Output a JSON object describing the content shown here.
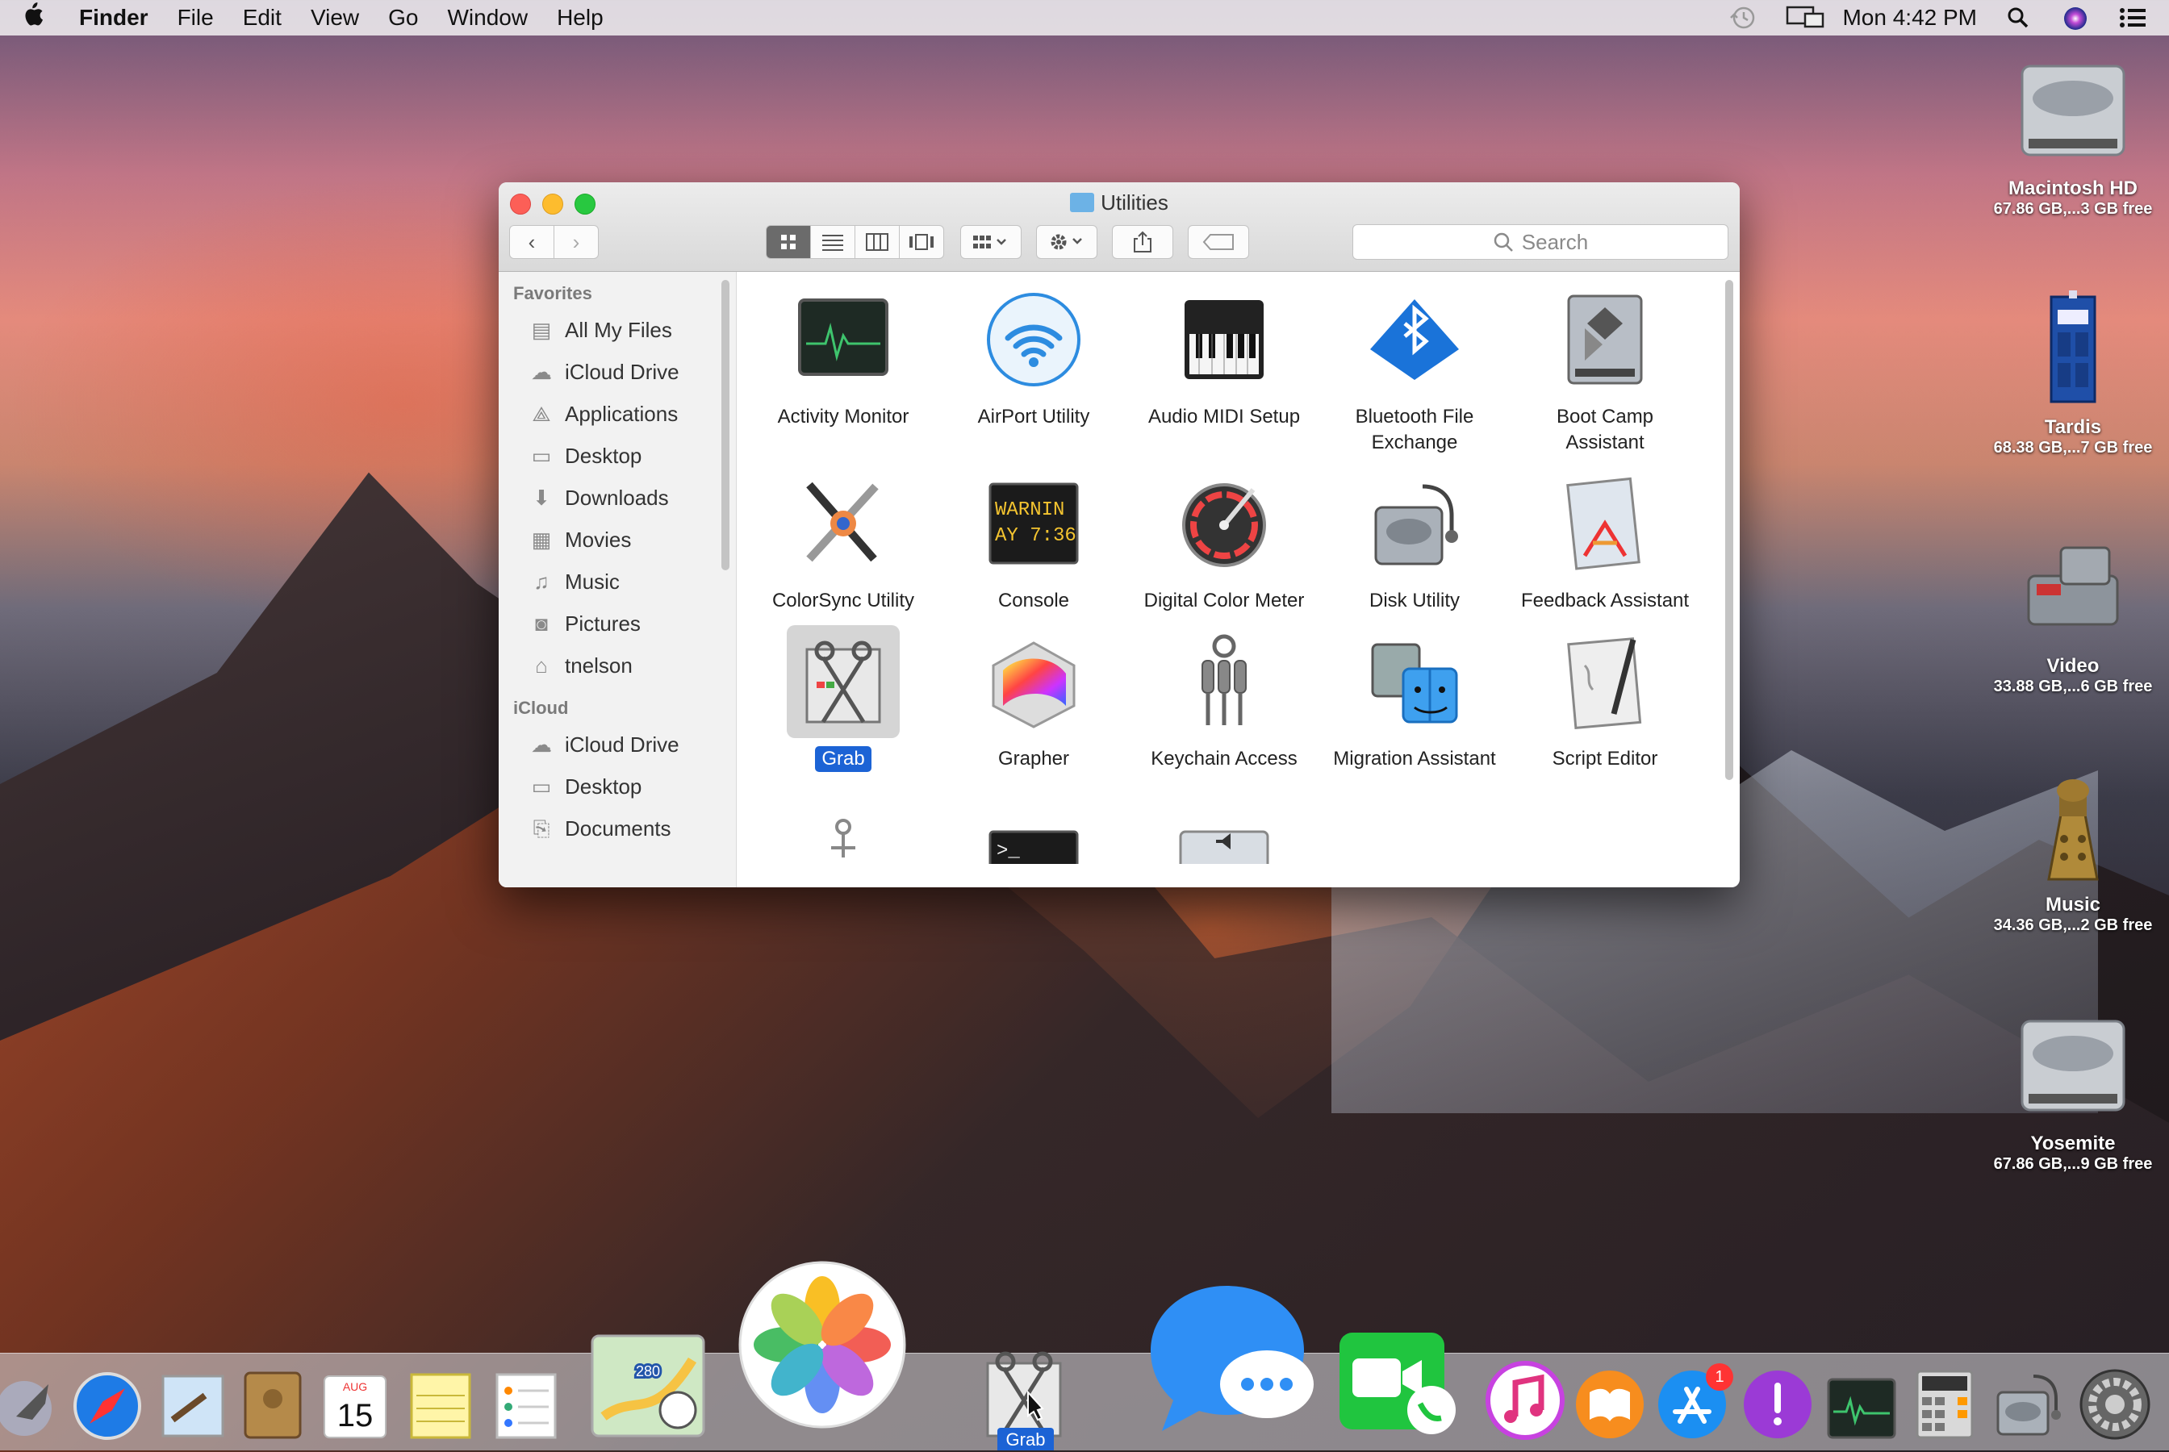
{
  "menubar": {
    "app_name": "Finder",
    "menus": [
      "File",
      "Edit",
      "View",
      "Go",
      "Window",
      "Help"
    ],
    "clock": "Mon 4:42 PM"
  },
  "desktop_volumes": [
    {
      "name": "Macintosh HD",
      "size": "67.86 GB,...3 GB free",
      "icon": "hard-drive-icon"
    },
    {
      "name": "Tardis",
      "size": "68.38 GB,...7 GB free",
      "icon": "tardis-icon"
    },
    {
      "name": "Video",
      "size": "33.88 GB,...6 GB free",
      "icon": "k9-robot-icon"
    },
    {
      "name": "Music",
      "size": "34.36 GB,...2 GB free",
      "icon": "dalek-icon"
    },
    {
      "name": "Yosemite",
      "size": "67.86 GB,...9 GB free",
      "icon": "hard-drive-icon"
    }
  ],
  "window": {
    "title": "Utilities",
    "search_placeholder": "Search"
  },
  "sidebar": {
    "favorites_header": "Favorites",
    "favorites": [
      "All My Files",
      "iCloud Drive",
      "Applications",
      "Desktop",
      "Downloads",
      "Movies",
      "Music",
      "Pictures",
      "tnelson"
    ],
    "icloud_header": "iCloud",
    "icloud": [
      "iCloud Drive",
      "Desktop",
      "Documents"
    ]
  },
  "apps": [
    "Activity Monitor",
    "AirPort Utility",
    "Audio MIDI Setup",
    "Bluetooth File Exchange",
    "Boot Camp Assistant",
    "ColorSync Utility",
    "Console",
    "Digital Color Meter",
    "Disk Utility",
    "Feedback Assistant",
    "Grab",
    "Grapher",
    "Keychain Access",
    "Migration Assistant",
    "Script Editor"
  ],
  "console_icon_text": [
    "WARNIN",
    "AY 7:36"
  ],
  "terminal_icon_text": ">_",
  "dock": {
    "grab_label": "Grab",
    "appstore_badge": "1",
    "calendar_month": "AUG",
    "calendar_day": "15",
    "maps_route": "280"
  },
  "colors": {
    "selection": "#1c63d5",
    "close": "#fc5f57",
    "minimize": "#fdbc2e",
    "maximize": "#28c840"
  }
}
